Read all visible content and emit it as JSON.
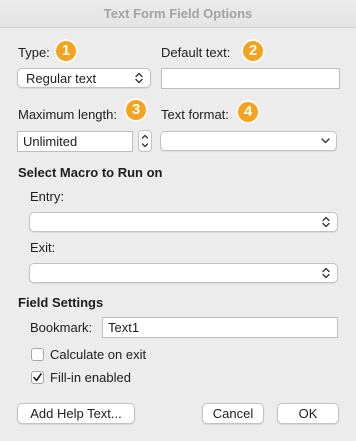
{
  "window": {
    "title": "Text Form Field Options"
  },
  "type": {
    "label": "Type:",
    "value": "Regular text"
  },
  "default_text": {
    "label": "Default text:",
    "value": ""
  },
  "max_length": {
    "label": "Maximum length:",
    "value": "Unlimited"
  },
  "text_format": {
    "label": "Text format:",
    "value": ""
  },
  "badges": [
    "1",
    "2",
    "3",
    "4"
  ],
  "macro": {
    "heading": "Select Macro to Run on",
    "entry_label": "Entry:",
    "entry_value": "",
    "exit_label": "Exit:",
    "exit_value": ""
  },
  "field_settings": {
    "heading": "Field Settings",
    "bookmark_label": "Bookmark:",
    "bookmark_value": "Text1",
    "calculate_label": "Calculate on exit",
    "calculate_checked": false,
    "fillin_label": "Fill-in enabled",
    "fillin_checked": true
  },
  "buttons": {
    "help": "Add Help Text...",
    "cancel": "Cancel",
    "ok": "OK"
  },
  "colors": {
    "badge": "#f5a31f",
    "background": "#ececec",
    "title_text": "#a3a3a3"
  }
}
